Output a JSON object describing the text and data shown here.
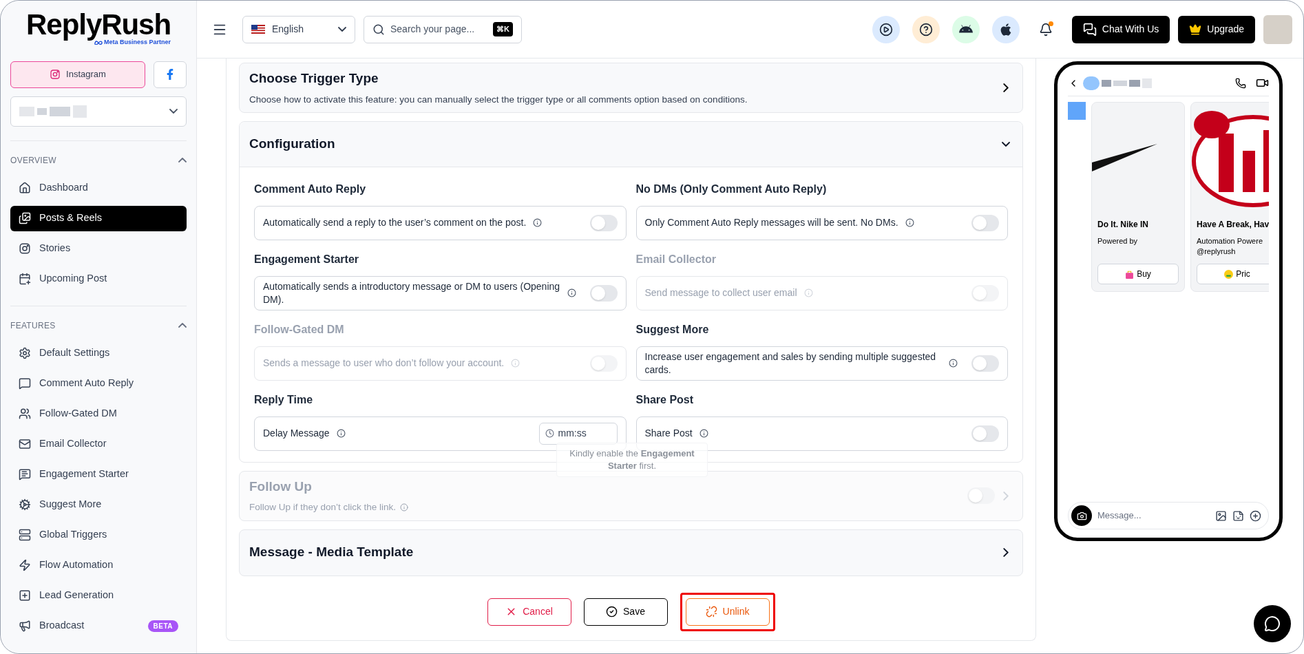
{
  "sidebar": {
    "logo": {
      "name": "ReplyRush",
      "tagline": "Meta Business Partner"
    },
    "platforms": [
      {
        "kind": "instagram",
        "label": "Instagram",
        "selected": true
      },
      {
        "kind": "facebook",
        "selected": false
      }
    ],
    "sections": [
      {
        "title": "OVERVIEW",
        "expanded": true,
        "items": [
          {
            "label": "Dashboard",
            "selected": false
          },
          {
            "label": "Posts & Reels",
            "selected": true
          },
          {
            "label": "Stories",
            "selected": false
          },
          {
            "label": "Upcoming Post",
            "selected": false
          }
        ]
      },
      {
        "title": "FEATURES",
        "expanded": true,
        "items": [
          {
            "label": "Default Settings",
            "selected": false
          },
          {
            "label": "Comment Auto Reply",
            "selected": false
          },
          {
            "label": "Follow-Gated DM",
            "selected": false
          },
          {
            "label": "Email Collector",
            "selected": false
          },
          {
            "label": "Engagement Starter",
            "selected": false
          },
          {
            "label": "Suggest More",
            "selected": false
          },
          {
            "label": "Global Triggers",
            "selected": false
          },
          {
            "label": "Flow Automation",
            "selected": false
          },
          {
            "label": "Lead Generation",
            "selected": false
          },
          {
            "label": "Broadcast",
            "selected": false,
            "badge": "BETA"
          }
        ]
      }
    ]
  },
  "topbar": {
    "language": "English",
    "search": {
      "placeholder": "Search your page...",
      "shortcut": "⌘K"
    },
    "notification_dot": true,
    "buttons": [
      "Chat With Us",
      "Upgrade"
    ]
  },
  "trigger": {
    "title": "Choose Trigger Type",
    "description": "Choose how to activate this feature: you can manually select the trigger type or all comments option based on conditions.",
    "expanded": false
  },
  "configuration": {
    "title": "Configuration",
    "expanded": true,
    "settings": [
      {
        "kind": "toggle",
        "title": "Comment Auto Reply",
        "description": "Automatically send a reply to the user’s comment on the post.",
        "disabled": false,
        "on": false
      },
      {
        "kind": "toggle",
        "title": "No DMs (Only Comment Auto Reply)",
        "description": "Only Comment Auto Reply messages will be sent. No DMs.",
        "disabled": false,
        "on": false
      },
      {
        "kind": "toggle",
        "title": "Engagement Starter",
        "description": "Automatically sends a introductory message or DM to users (Opening DM).",
        "disabled": false,
        "on": false
      },
      {
        "kind": "toggle",
        "title": "Email Collector",
        "description": "Send message to collect user email",
        "disabled": true,
        "on": false
      },
      {
        "kind": "toggle",
        "title": "Follow-Gated DM",
        "description": "Sends a message to user who don’t follow your account.",
        "disabled": true,
        "on": false
      },
      {
        "kind": "toggle",
        "title": "Suggest More",
        "description": "Increase user engagement and sales by sending multiple suggested cards.",
        "disabled": false,
        "on": false
      },
      {
        "kind": "time",
        "title": "Reply Time",
        "description": "Delay Message",
        "disabled": false,
        "placeholder": "mm:ss"
      },
      {
        "kind": "toggle",
        "title": "Share Post",
        "description": "Share Post",
        "disabled": false,
        "on": false
      }
    ],
    "tooltip": "Kindly enable the **Engagement Starter** first."
  },
  "follow_up": {
    "title": "Follow Up",
    "description": "Follow Up if they don’t click the link.",
    "disabled": true,
    "on": false
  },
  "media_template": {
    "title": "Message - Media Template",
    "expanded": false
  },
  "actions": [
    {
      "kind": "cancel",
      "label": "Cancel",
      "highlighted": false
    },
    {
      "kind": "save",
      "label": "Save",
      "highlighted": false
    },
    {
      "kind": "unlink",
      "label": "Unlink",
      "highlighted": true
    }
  ],
  "phone": {
    "cards": [
      {
        "kind": "swoosh",
        "title": "Do It. Nike IN",
        "text": "Powered by",
        "button": "Buy"
      },
      {
        "kind": "candy",
        "title": "Have A Break, Hav",
        "text": "Automation Powere\n@replyrush",
        "button": "Pric"
      }
    ],
    "placeholder": "Message..."
  }
}
